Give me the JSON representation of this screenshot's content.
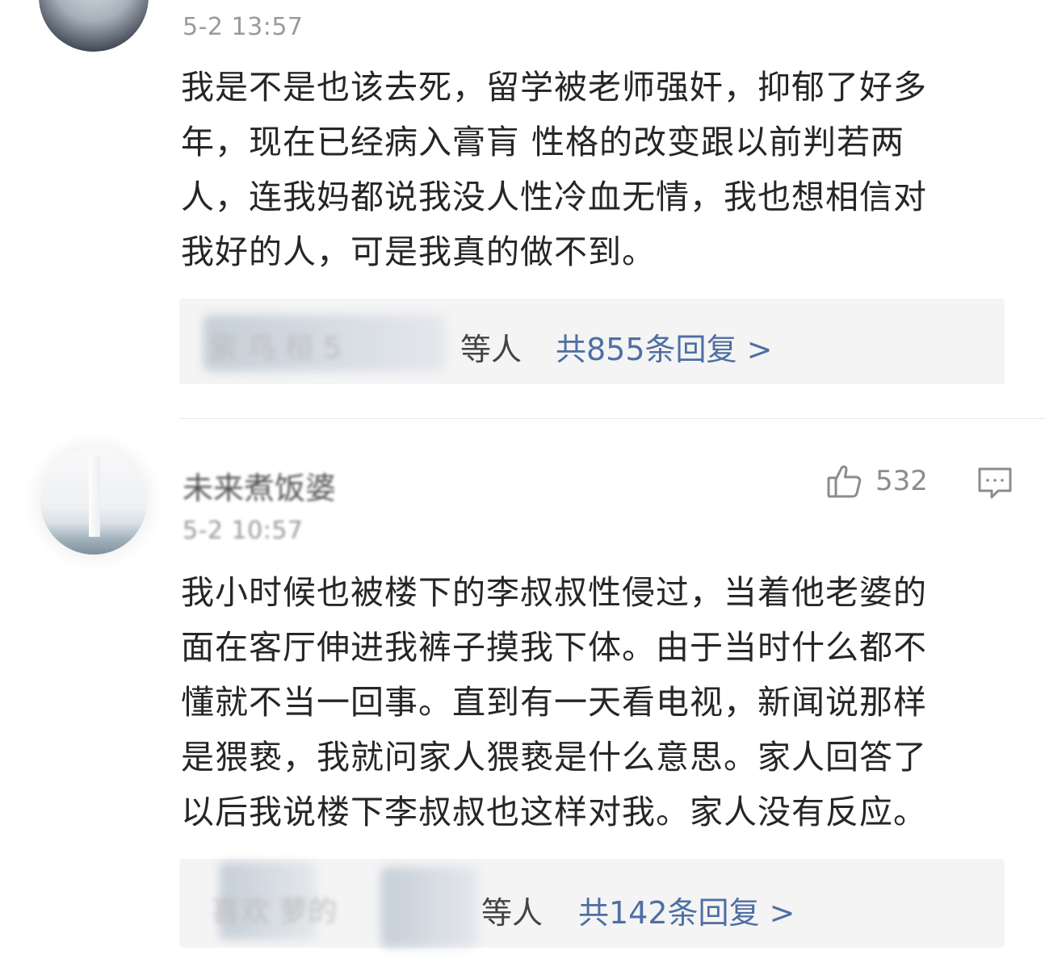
{
  "comments": [
    {
      "timestamp": "5-2 13:57",
      "text_lines": [
        "我是不是也该去死，留学被老师强奸，抑郁了好多",
        "年，现在已经病入膏肓 性格的改变跟以前判若两",
        "人，连我妈都说我没人性冷血无情，我也想相信对",
        "我好的人，可是我真的做不到。"
      ],
      "replies": {
        "names_blurred": "紫 鸟 桓 5",
        "suffix": "等人",
        "count_label": "共855条回复 >"
      }
    },
    {
      "username": "未来煮饭婆",
      "timestamp": "5-2 10:57",
      "likes": "532",
      "text_lines": [
        "我小时候也被楼下的李叔叔性侵过，当着他老婆的",
        "面在客厅伸进我裤子摸我下体。由于当时什么都不",
        "懂就不当一回事。直到有一天看电视，新闻说那样",
        "是猥亵，我就问家人猥亵是什么意思。家人回答了",
        "以后我说楼下李叔叔也这样对我。家人没有反应。"
      ],
      "replies": {
        "names_blurred": "喜欢 萝的",
        "suffix": "等人",
        "count_label": "共142条回复 >"
      }
    }
  ],
  "icons": {
    "like": "thumbs-up-icon",
    "comment": "comment-bubble-icon"
  },
  "colors": {
    "link": "#4f6fa3",
    "meta": "#9a9a9a",
    "reply_bg": "#f4f4f5"
  }
}
